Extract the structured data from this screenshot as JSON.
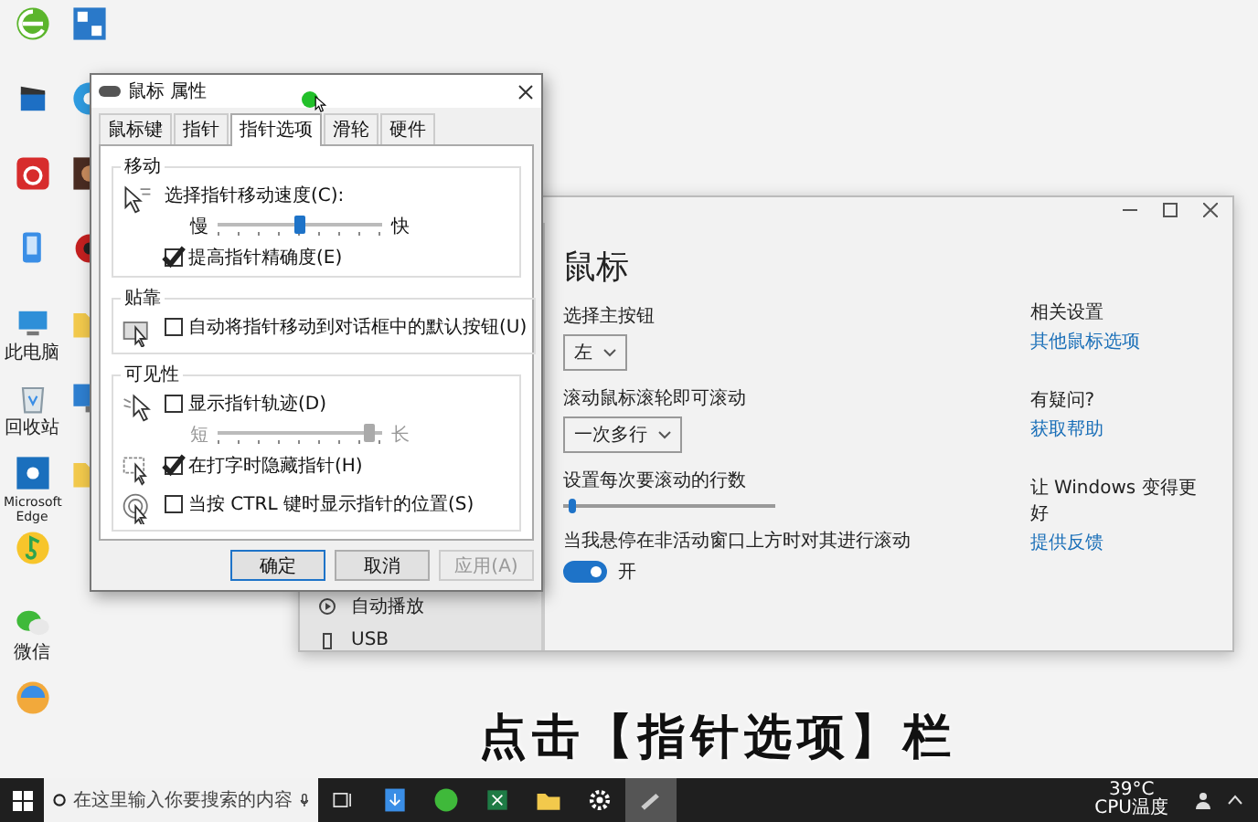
{
  "desktop_icons": [
    {
      "kind": "browser"
    },
    {
      "kind": "video"
    },
    {
      "kind": "music"
    },
    {
      "kind": "phone"
    },
    {
      "kind": "pc",
      "label": "此电脑"
    },
    {
      "kind": "trash",
      "label": "回收站"
    },
    {
      "kind": "edge",
      "label": "Microsoft Edge"
    },
    {
      "kind": "qqmusic"
    },
    {
      "kind": "wechat",
      "label": "微信"
    },
    {
      "kind": "game"
    },
    {
      "kind": "app"
    },
    {
      "kind": "chat"
    },
    {
      "kind": "photo"
    },
    {
      "kind": "bug"
    },
    {
      "kind": "folder"
    },
    {
      "kind": "monitor"
    },
    {
      "kind": "folder"
    }
  ],
  "mouse_dialog": {
    "title": "鼠标 属性",
    "tabs": [
      {
        "label": "鼠标键",
        "selected": false
      },
      {
        "label": "指针",
        "selected": false
      },
      {
        "label": "指针选项",
        "selected": true
      },
      {
        "label": "滑轮",
        "selected": false
      },
      {
        "label": "硬件",
        "selected": false
      }
    ],
    "sections": [
      {
        "title": "移动",
        "groups": [
          {
            "kind": "speed",
            "rows": [
              {
                "kind": "slider",
                "label": "选择指针移动速度(C):",
                "min_label": "慢",
                "max_label": "快",
                "level": 0.5,
                "disabled": false
              },
              {
                "kind": "checkbox",
                "label": "提高指针精确度(E)",
                "checked": true
              }
            ]
          }
        ]
      },
      {
        "title": "贴靠",
        "groups": [
          {
            "kind": "snap",
            "rows": [
              {
                "kind": "checkbox",
                "label": "自动将指针移动到对话框中的默认按钮(U)",
                "checked": false
              }
            ]
          }
        ]
      },
      {
        "title": "可见性",
        "groups": [
          {
            "kind": "trail",
            "rows": [
              {
                "kind": "checkbox",
                "label": "显示指针轨迹(D)",
                "checked": false
              },
              {
                "kind": "slider",
                "min_label": "短",
                "max_label": "长",
                "level": 0.95,
                "disabled": true
              }
            ]
          },
          {
            "kind": "hide",
            "rows": [
              {
                "kind": "checkbox",
                "label": "在打字时隐藏指针(H)",
                "checked": true
              }
            ]
          },
          {
            "kind": "ctrl",
            "rows": [
              {
                "kind": "checkbox",
                "label": "当按 CTRL 键时显示指针的位置(S)",
                "checked": false
              }
            ]
          }
        ]
      }
    ],
    "buttons": [
      {
        "label": "确定",
        "default": true,
        "disabled": false
      },
      {
        "label": "取消",
        "default": false,
        "disabled": false
      },
      {
        "label": "应用(A)",
        "default": false,
        "disabled": true
      }
    ]
  },
  "settings_window": {
    "nav_items": [
      {
        "kind": "autoplay",
        "label": "自动播放"
      },
      {
        "kind": "usb",
        "label": "USB"
      }
    ],
    "page_title": "鼠标",
    "controls": [
      {
        "kind": "dropdown",
        "label": "选择主按钮",
        "value": "左"
      },
      {
        "kind": "dropdown",
        "label": "滚动鼠标滚轮即可滚动",
        "value": "一次多行"
      },
      {
        "kind": "slider",
        "label": "设置每次要滚动的行数",
        "level": 0.03
      },
      {
        "kind": "toggle",
        "label": "当我悬停在非活动窗口上方时对其进行滚动",
        "on": true,
        "state_text": "开"
      }
    ],
    "related": [
      {
        "heading": "相关设置",
        "link": "其他鼠标选项"
      },
      {
        "heading": "有疑问?",
        "link": "获取帮助"
      },
      {
        "heading": "让 Windows 变得更好",
        "link": "提供反馈"
      }
    ]
  },
  "caption": "点击【指针选项】栏",
  "taskbar": {
    "search_placeholder": "在这里输入你要搜索的内容",
    "apps": [
      {
        "kind": "taskview",
        "active": false
      },
      {
        "kind": "download",
        "active": false
      },
      {
        "kind": "wechat",
        "active": false
      },
      {
        "kind": "excel",
        "active": false
      },
      {
        "kind": "folder",
        "active": false
      },
      {
        "kind": "settings",
        "active": false
      },
      {
        "kind": "pen",
        "active": true
      }
    ],
    "temperature": "39°C",
    "temperature_label": "CPU温度"
  }
}
